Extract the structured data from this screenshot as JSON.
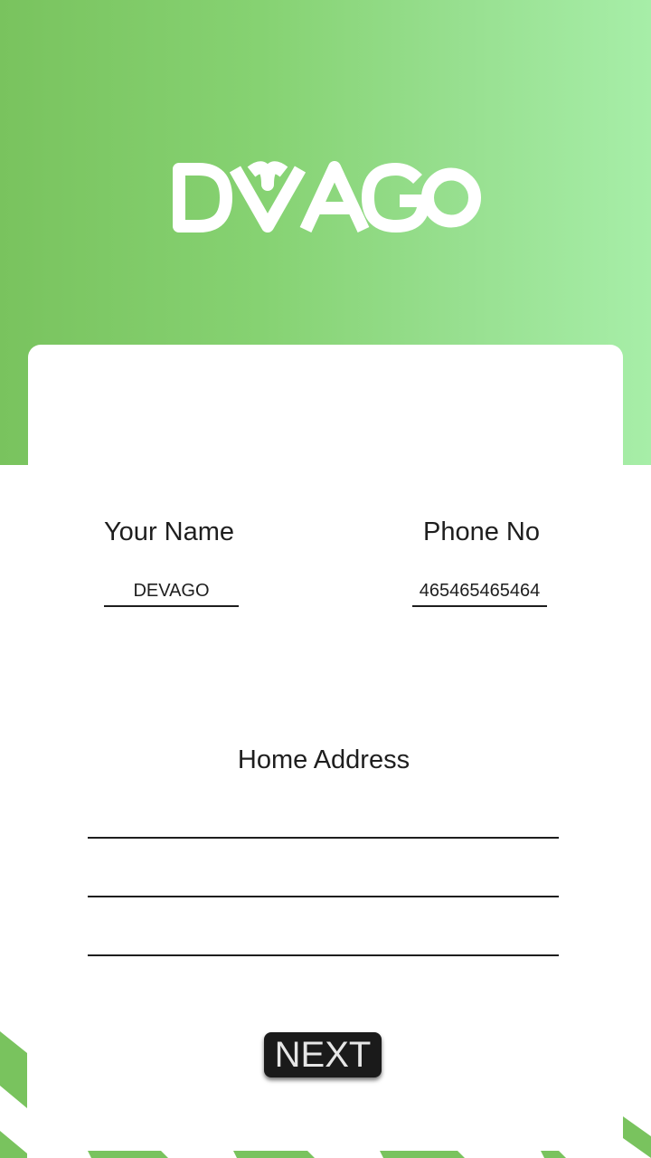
{
  "brand": {
    "logo_text": "DVAGO",
    "colors": {
      "gradient_start": "#79c35e",
      "gradient_end": "#a7eea8",
      "button_bg": "#1a1a1a",
      "button_text": "#e6e6e6",
      "text": "#1e1e1e"
    }
  },
  "form": {
    "name_label": "Your Name",
    "name_value": "DEVAGO",
    "phone_label": "Phone No",
    "phone_value": "465465465464",
    "address_label": "Home Address",
    "address_line1": "",
    "address_line2": "",
    "address_line3": ""
  },
  "actions": {
    "next_label": "NEXT"
  }
}
